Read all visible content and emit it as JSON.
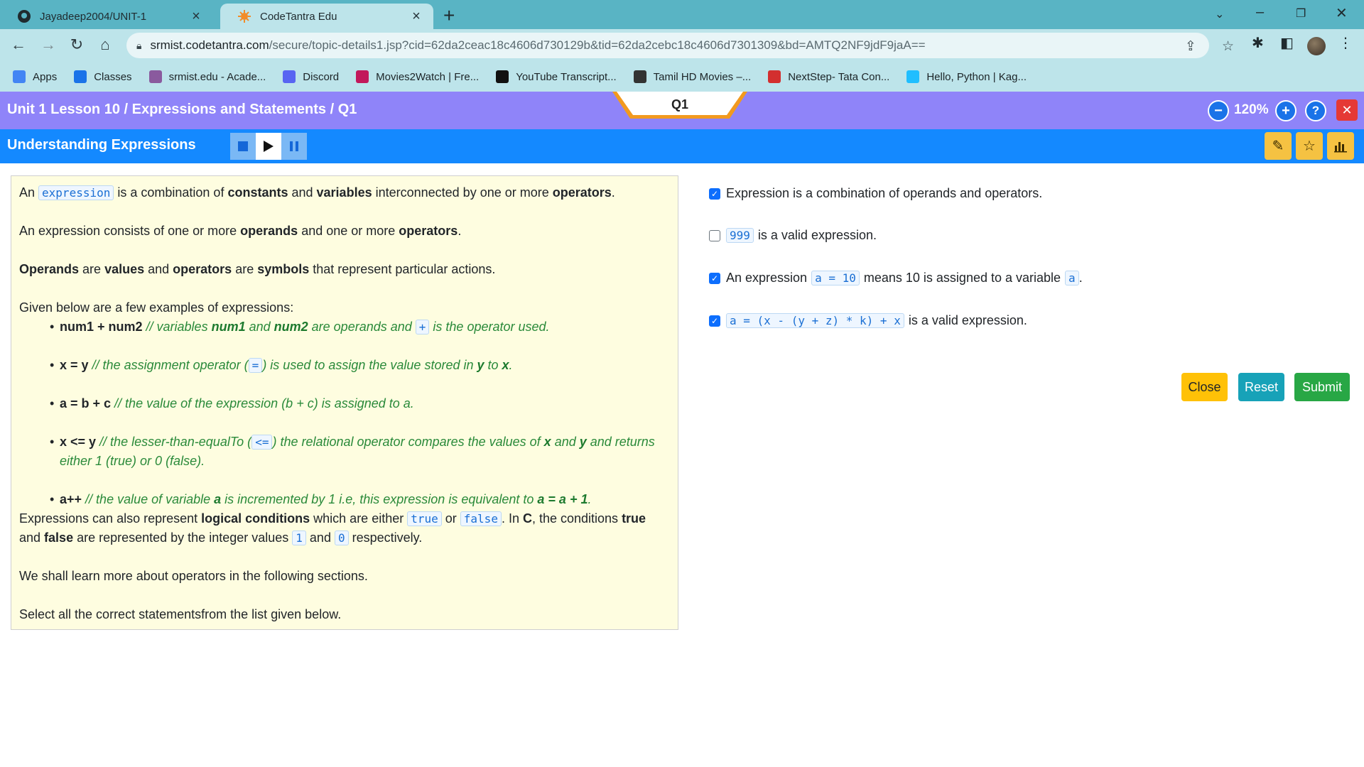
{
  "browser": {
    "tabs": [
      {
        "title": "Jayadeep2004/UNIT-1"
      },
      {
        "title": "CodeTantra Edu"
      }
    ],
    "url_host": "srmist.codetantra.com",
    "url_path": "/secure/topic-details1.jsp?cid=62da2ceac18c4606d730129b&tid=62da2cebc18c4606d7301309&bd=AMTQ2NF9jdF9jaA==",
    "bookmarks": [
      {
        "label": "Apps",
        "color": "#4285f4"
      },
      {
        "label": "Classes",
        "color": "#1a73e8"
      },
      {
        "label": "srmist.edu - Acade...",
        "color": "#8a5a9e"
      },
      {
        "label": "Discord",
        "color": "#5865f2"
      },
      {
        "label": "Movies2Watch | Fre...",
        "color": "#c2185b"
      },
      {
        "label": "YouTube Transcript...",
        "color": "#111111"
      },
      {
        "label": "Tamil HD Movies –...",
        "color": "#333333"
      },
      {
        "label": "NextStep- Tata Con...",
        "color": "#d32f2f"
      },
      {
        "label": "Hello, Python | Kag...",
        "color": "#20beff"
      }
    ]
  },
  "header": {
    "breadcrumb": "Unit 1 Lesson 10 / Expressions and Statements / Q1",
    "question_tab": "Q1",
    "zoom": "120%",
    "lesson_title": "Understanding Expressions"
  },
  "explanation": {
    "p1": {
      "t1": "An ",
      "c1": "expression",
      "t2": " is a combination of ",
      "b1": "constants",
      "t3": " and ",
      "b2": "variables",
      "t4": " interconnected by one or more ",
      "b3": "operators",
      "t5": "."
    },
    "p2": {
      "t1": "An expression consists of one or more ",
      "b1": "operands",
      "t2": " and one or more ",
      "b3": "operators",
      "t3": "."
    },
    "p3": {
      "b1": "Operands",
      "t1": " are ",
      "b2": "values",
      "t2": " and ",
      "b3": "operators",
      "t3": " are ",
      "b4": "symbols",
      "t4": " that represent particular actions."
    },
    "p4_intro": "Given below are a few examples of expressions:",
    "ex1": {
      "code": "num1 + num2",
      "c1": " // variables ",
      "b1": "num1",
      "c2": " and ",
      "b2": "num2",
      "c3": " are operands and ",
      "op": "+",
      "c4": " is the operator used."
    },
    "ex2": {
      "code": "x = y",
      "c1": " // the assignment operator (",
      "op": "=",
      "c2": ") is used to assign the value stored in ",
      "b1": "y",
      "c3": " to ",
      "b2": "x",
      "c4": "."
    },
    "ex3": {
      "code": "a = b + c",
      "c1": " // the value of the expression (b + c) is assigned to a."
    },
    "ex4": {
      "code": "x <= y",
      "c1": " // the lesser-than-equalTo (",
      "op": "<=",
      "c2": ") the relational operator compares the values of ",
      "b1": "x",
      "c3": " and ",
      "b2": "y",
      "c4": " and returns either 1 (true) or 0 (false)."
    },
    "ex5": {
      "code": "a++",
      "c1": " // the value of variable ",
      "b1": "a",
      "c2": " is incremented by 1 i.e, this expression is equivalent to ",
      "b2": "a = a + 1",
      "c3": "."
    },
    "p5": {
      "t1": "Expressions can also represent ",
      "b1": "logical conditions",
      "t2": " which are either ",
      "c1": "true",
      "t3": " or ",
      "c2": "false",
      "t4": ". In ",
      "b2": "C",
      "t5": ", the conditions ",
      "b3": "true",
      "t6": " and ",
      "b4": "false",
      "t7": " are represented by the integer values ",
      "c3": "1",
      "t8": " and ",
      "c4": "0",
      "t9": " respectively."
    },
    "p6": "We shall learn more about operators in the following sections.",
    "p7": "Select all the correct statementsfrom the list given below."
  },
  "options": [
    {
      "checked": true,
      "text": "Expression is a combination of operands and operators."
    },
    {
      "checked": false,
      "code": "999",
      "text": "is a valid expression."
    },
    {
      "checked": true,
      "pre": "An expression",
      "code": "a = 10",
      "mid": "means 10 is assigned to a variable",
      "code2": "a",
      "post": "."
    },
    {
      "checked": true,
      "code": "a = (x - (y + z) * k) + x",
      "text": "is a valid expression."
    }
  ],
  "buttons": {
    "close": "Close",
    "reset": "Reset",
    "submit": "Submit"
  },
  "colors": {
    "purple_bar": "#8f84f9",
    "blue_bar": "#1489ff",
    "close_btn": "#ffc107",
    "reset_btn": "#17a2b8",
    "submit_btn": "#28a745"
  }
}
